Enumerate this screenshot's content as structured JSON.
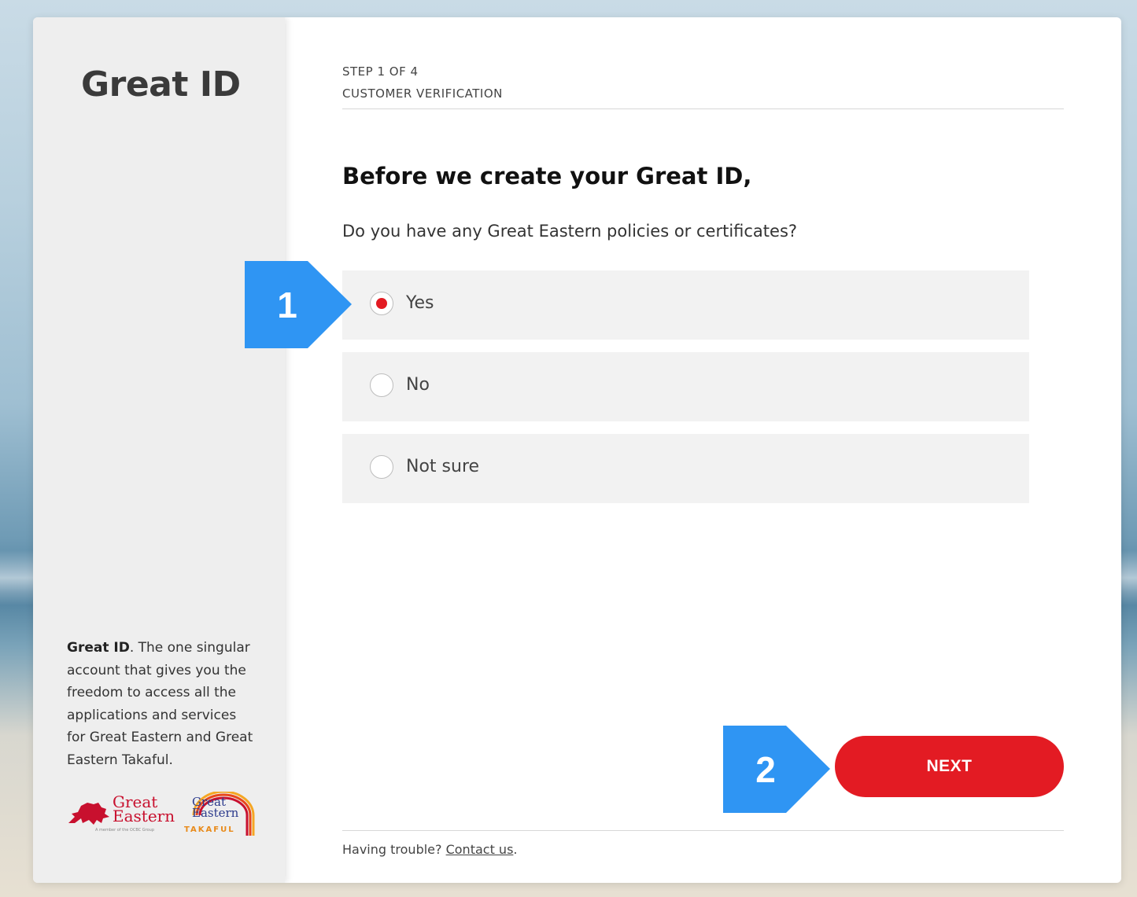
{
  "brand": {
    "title": "Great ID",
    "description_bold": "Great ID",
    "description_rest": ". The one singular account that gives you the freedom to access all the applications and services for Great Eastern and Great Eastern Takaful.",
    "logo_ge_line1": "Great",
    "logo_ge_line2": "Eastern",
    "logo_ge_tagline": "A member of the OCBC Group",
    "logo_takaful_line1": "Great",
    "logo_takaful_line2": "Eastern",
    "logo_takaful_sub": "TAKAFUL"
  },
  "step": {
    "counter": "STEP 1 OF 4",
    "name": "CUSTOMER VERIFICATION"
  },
  "form": {
    "heading": "Before we create your Great ID,",
    "question": "Do you have any Great Eastern policies or certificates?",
    "options": [
      {
        "label": "Yes",
        "selected": true
      },
      {
        "label": "No",
        "selected": false
      },
      {
        "label": "Not sure",
        "selected": false
      }
    ],
    "next_label": "NEXT"
  },
  "footer": {
    "prefix": "Having trouble? ",
    "link": "Contact us",
    "suffix": "."
  },
  "callouts": [
    {
      "number": "1"
    },
    {
      "number": "2"
    }
  ],
  "colors": {
    "accent": "#e31b23",
    "callout": "#2f95f3"
  }
}
